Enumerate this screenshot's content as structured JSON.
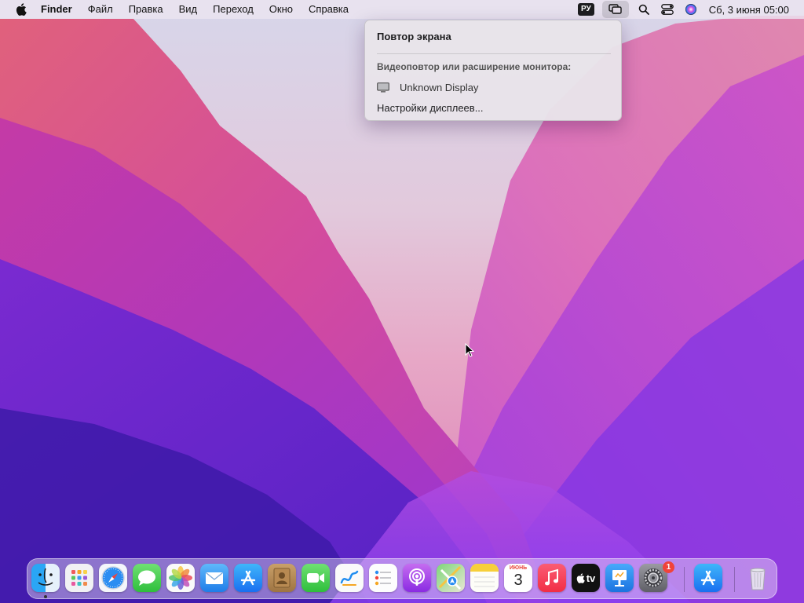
{
  "menubar": {
    "app_name": "Finder",
    "items": [
      "Файл",
      "Правка",
      "Вид",
      "Переход",
      "Окно",
      "Справка"
    ],
    "input_language": "РУ",
    "clock": "Сб, 3 июня  05:00",
    "status_icons": [
      "screen-mirroring-icon",
      "spotlight-search-icon",
      "control-center-icon",
      "siri-icon"
    ]
  },
  "mirror_menu": {
    "title": "Повтор экрана",
    "section_label": "Видеоповтор или расширение монитора:",
    "display_name": "Unknown Display",
    "settings_label": "Настройки дисплеев..."
  },
  "dock": {
    "apps": [
      {
        "name": "finder",
        "running": true
      },
      {
        "name": "launchpad"
      },
      {
        "name": "safari"
      },
      {
        "name": "messages"
      },
      {
        "name": "photos"
      },
      {
        "name": "mail"
      },
      {
        "name": "app-store"
      },
      {
        "name": "contacts"
      },
      {
        "name": "facetime"
      },
      {
        "name": "freeform"
      },
      {
        "name": "reminders"
      },
      {
        "name": "podcasts"
      },
      {
        "name": "maps"
      },
      {
        "name": "notes"
      },
      {
        "name": "calendar"
      },
      {
        "name": "music"
      },
      {
        "name": "apple-tv"
      },
      {
        "name": "keynote"
      },
      {
        "name": "system-settings",
        "badge": "1"
      },
      {
        "name": "app-store-download"
      },
      {
        "name": "trash"
      }
    ],
    "calendar_month": "ИЮНЬ",
    "calendar_day": "3",
    "tv_label": "tv"
  },
  "colors": {
    "accent": "#f0433a",
    "menubar_bg": "#ece4f0"
  }
}
